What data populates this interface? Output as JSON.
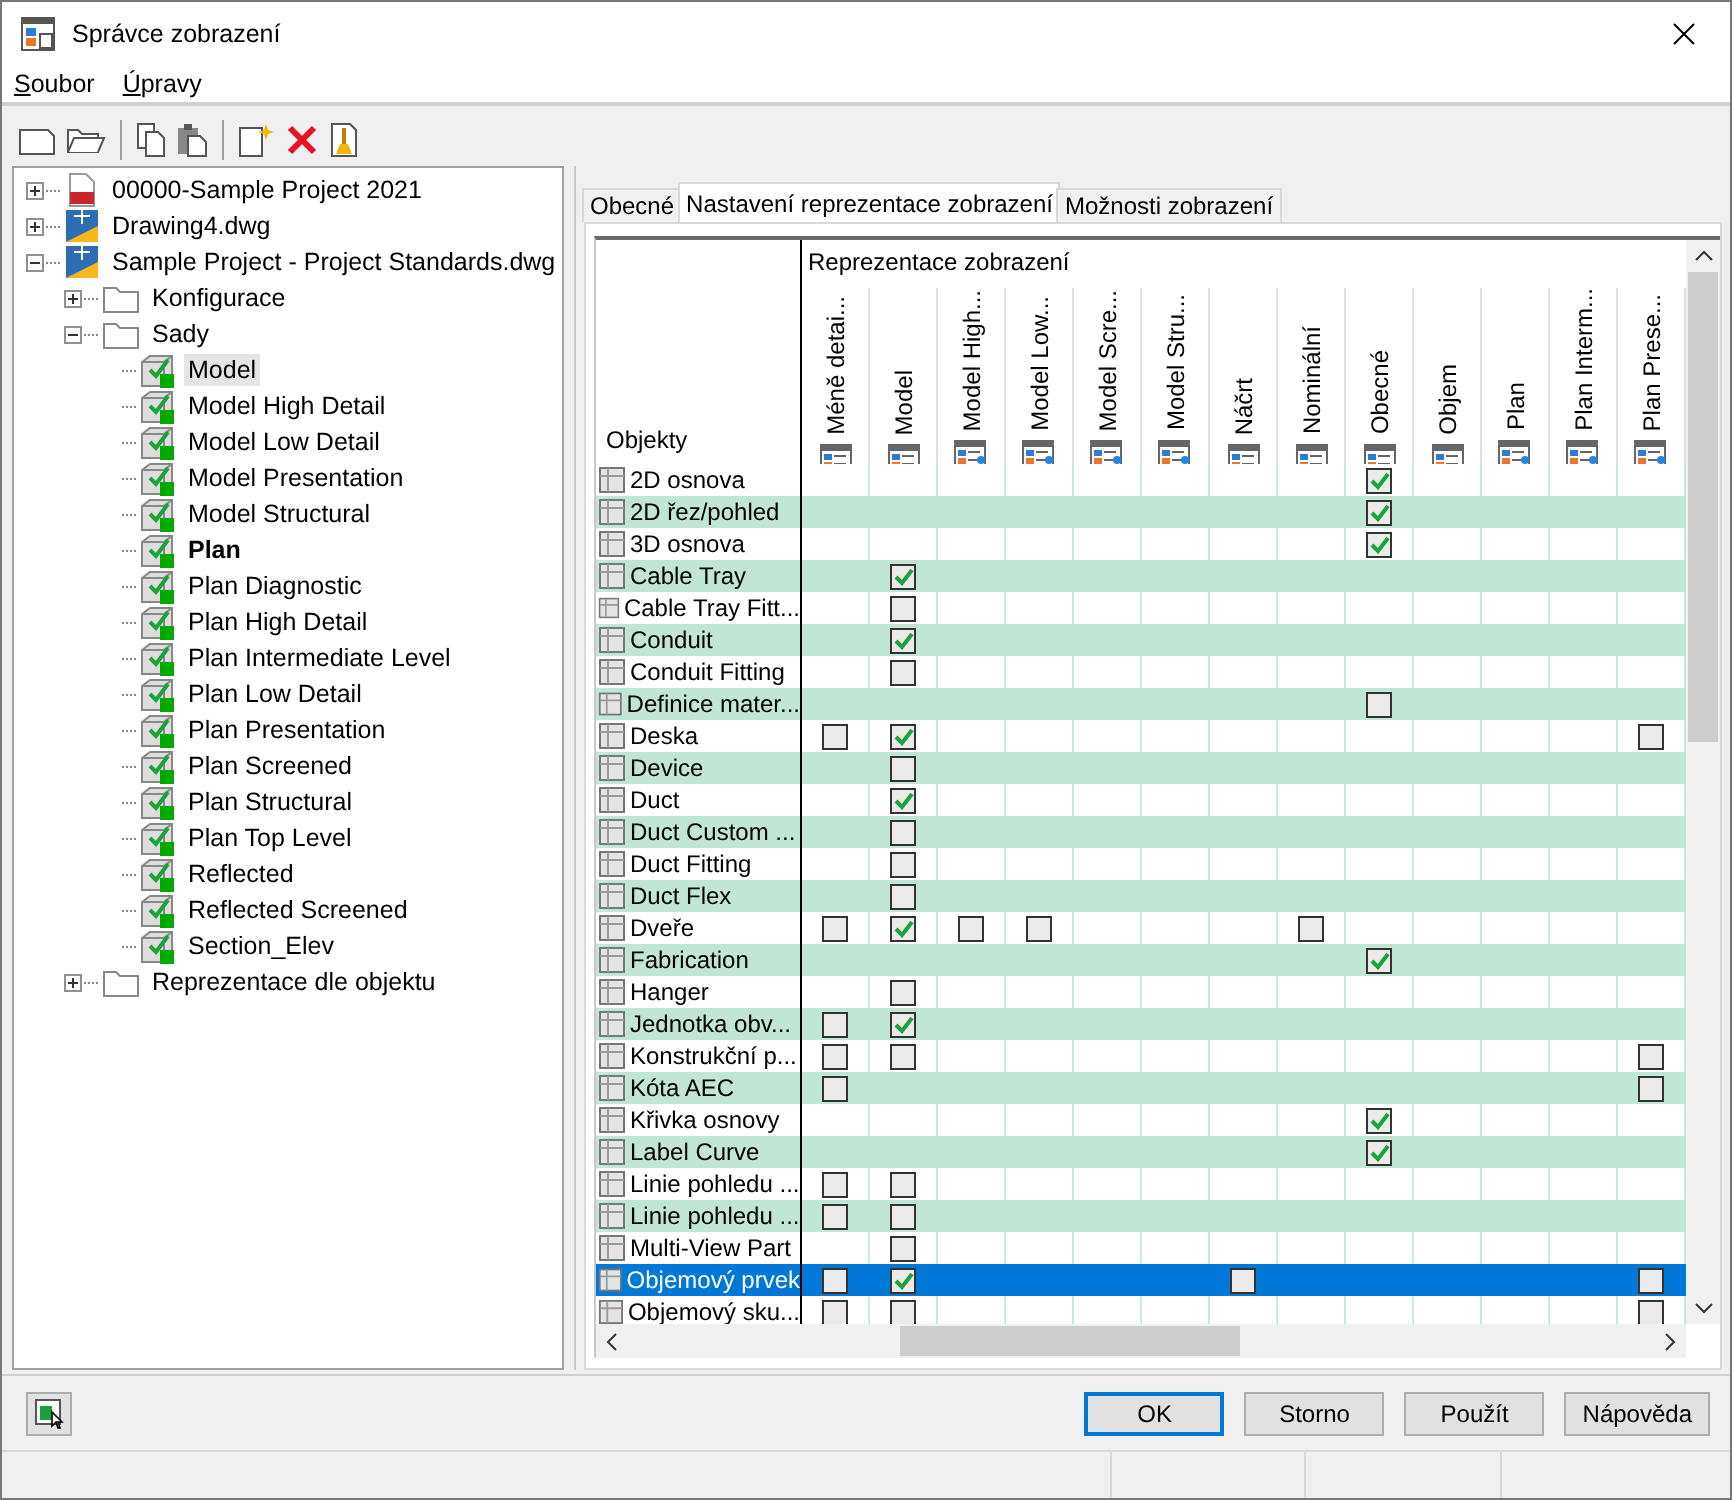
{
  "window": {
    "title": "Správce zobrazení"
  },
  "menu": [
    "Soubor",
    "Úpravy"
  ],
  "tree": [
    {
      "label": "00000-Sample Project 2021",
      "kind": "project",
      "expanded": false
    },
    {
      "label": "Drawing4.dwg",
      "kind": "drawing",
      "expanded": false
    },
    {
      "label": "Sample Project - Project Standards.dwg",
      "kind": "drawing",
      "expanded": true,
      "children": [
        {
          "label": "Konfigurace",
          "kind": "folder",
          "expanded": false
        },
        {
          "label": "Sady",
          "kind": "folder",
          "expanded": true,
          "children": [
            {
              "label": "Model",
              "kind": "set",
              "selected": true,
              "active": false
            },
            {
              "label": "Model High Detail",
              "kind": "set",
              "selected": false,
              "active": false
            },
            {
              "label": "Model Low Detail",
              "kind": "set",
              "selected": false,
              "active": false
            },
            {
              "label": "Model Presentation",
              "kind": "set",
              "selected": false,
              "active": false
            },
            {
              "label": "Model Structural",
              "kind": "set",
              "selected": false,
              "active": false
            },
            {
              "label": "Plan",
              "kind": "set",
              "selected": false,
              "active": true
            },
            {
              "label": "Plan Diagnostic",
              "kind": "set",
              "selected": false,
              "active": false
            },
            {
              "label": "Plan High Detail",
              "kind": "set",
              "selected": false,
              "active": false
            },
            {
              "label": "Plan Intermediate Level",
              "kind": "set",
              "selected": false,
              "active": false
            },
            {
              "label": "Plan Low Detail",
              "kind": "set",
              "selected": false,
              "active": false
            },
            {
              "label": "Plan Presentation",
              "kind": "set",
              "selected": false,
              "active": false
            },
            {
              "label": "Plan Screened",
              "kind": "set",
              "selected": false,
              "active": false
            },
            {
              "label": "Plan Structural",
              "kind": "set",
              "selected": false,
              "active": false
            },
            {
              "label": "Plan Top Level",
              "kind": "set",
              "selected": false,
              "active": false
            },
            {
              "label": "Reflected",
              "kind": "set",
              "selected": false,
              "active": false
            },
            {
              "label": "Reflected Screened",
              "kind": "set",
              "selected": false,
              "active": false
            },
            {
              "label": "Section_Elev",
              "kind": "set",
              "selected": false,
              "active": false
            }
          ]
        },
        {
          "label": "Reprezentace dle objektu",
          "kind": "folder",
          "expanded": false
        }
      ]
    }
  ],
  "tabs": [
    {
      "label": "Obecné",
      "selected": false
    },
    {
      "label": "Nastavení reprezentace zobrazení",
      "selected": true
    },
    {
      "label": "Možnosti zobrazení",
      "selected": false
    }
  ],
  "table": {
    "group_label": "Reprezentace zobrazení",
    "row_header": "Objekty",
    "columns": [
      {
        "label": "Méně detai...",
        "kind": "standard"
      },
      {
        "label": "Model",
        "kind": "standard"
      },
      {
        "label": "Model High...",
        "kind": "custom"
      },
      {
        "label": "Model Low...",
        "kind": "custom"
      },
      {
        "label": "Model Scre...",
        "kind": "custom"
      },
      {
        "label": "Model Stru...",
        "kind": "custom"
      },
      {
        "label": "Náčrt",
        "kind": "standard"
      },
      {
        "label": "Nominální",
        "kind": "standard"
      },
      {
        "label": "Obecné",
        "kind": "standard"
      },
      {
        "label": "Objem",
        "kind": "standard"
      },
      {
        "label": "Plan",
        "kind": "custom"
      },
      {
        "label": "Plan Interm...",
        "kind": "custom"
      },
      {
        "label": "Plan Prese...",
        "kind": "custom"
      }
    ],
    "rows": [
      {
        "label": "2D osnova",
        "selected": false,
        "cells": [
          null,
          null,
          null,
          null,
          null,
          null,
          null,
          null,
          true,
          null,
          null,
          null,
          null
        ]
      },
      {
        "label": "2D řez/pohled",
        "selected": false,
        "cells": [
          null,
          null,
          null,
          null,
          null,
          null,
          null,
          null,
          true,
          null,
          null,
          null,
          null
        ]
      },
      {
        "label": "3D osnova",
        "selected": false,
        "cells": [
          null,
          null,
          null,
          null,
          null,
          null,
          null,
          null,
          true,
          null,
          null,
          null,
          null
        ]
      },
      {
        "label": "Cable Tray",
        "selected": false,
        "cells": [
          null,
          true,
          null,
          null,
          null,
          null,
          null,
          null,
          null,
          null,
          null,
          null,
          null
        ]
      },
      {
        "label": "Cable Tray Fitt...",
        "selected": false,
        "cells": [
          null,
          false,
          null,
          null,
          null,
          null,
          null,
          null,
          null,
          null,
          null,
          null,
          null
        ]
      },
      {
        "label": "Conduit",
        "selected": false,
        "cells": [
          null,
          true,
          null,
          null,
          null,
          null,
          null,
          null,
          null,
          null,
          null,
          null,
          null
        ]
      },
      {
        "label": "Conduit Fitting",
        "selected": false,
        "cells": [
          null,
          false,
          null,
          null,
          null,
          null,
          null,
          null,
          null,
          null,
          null,
          null,
          null
        ]
      },
      {
        "label": "Definice mater...",
        "selected": false,
        "cells": [
          null,
          null,
          null,
          null,
          null,
          null,
          null,
          null,
          false,
          null,
          null,
          null,
          null
        ]
      },
      {
        "label": "Deska",
        "selected": false,
        "cells": [
          false,
          true,
          null,
          null,
          null,
          null,
          null,
          null,
          null,
          null,
          null,
          null,
          false
        ]
      },
      {
        "label": "Device",
        "selected": false,
        "cells": [
          null,
          false,
          null,
          null,
          null,
          null,
          null,
          null,
          null,
          null,
          null,
          null,
          null
        ]
      },
      {
        "label": "Duct",
        "selected": false,
        "cells": [
          null,
          true,
          null,
          null,
          null,
          null,
          null,
          null,
          null,
          null,
          null,
          null,
          null
        ]
      },
      {
        "label": "Duct Custom ...",
        "selected": false,
        "cells": [
          null,
          false,
          null,
          null,
          null,
          null,
          null,
          null,
          null,
          null,
          null,
          null,
          null
        ]
      },
      {
        "label": "Duct Fitting",
        "selected": false,
        "cells": [
          null,
          false,
          null,
          null,
          null,
          null,
          null,
          null,
          null,
          null,
          null,
          null,
          null
        ]
      },
      {
        "label": "Duct Flex",
        "selected": false,
        "cells": [
          null,
          false,
          null,
          null,
          null,
          null,
          null,
          null,
          null,
          null,
          null,
          null,
          null
        ]
      },
      {
        "label": "Dveře",
        "selected": false,
        "cells": [
          false,
          true,
          false,
          false,
          null,
          null,
          null,
          false,
          null,
          null,
          null,
          null,
          null
        ]
      },
      {
        "label": "Fabrication",
        "selected": false,
        "cells": [
          null,
          null,
          null,
          null,
          null,
          null,
          null,
          null,
          true,
          null,
          null,
          null,
          null
        ]
      },
      {
        "label": "Hanger",
        "selected": false,
        "cells": [
          null,
          false,
          null,
          null,
          null,
          null,
          null,
          null,
          null,
          null,
          null,
          null,
          null
        ]
      },
      {
        "label": "Jednotka obv...",
        "selected": false,
        "cells": [
          false,
          true,
          null,
          null,
          null,
          null,
          null,
          null,
          null,
          null,
          null,
          null,
          null
        ]
      },
      {
        "label": "Konstrukční p...",
        "selected": false,
        "cells": [
          false,
          false,
          null,
          null,
          null,
          null,
          null,
          null,
          null,
          null,
          null,
          null,
          false
        ]
      },
      {
        "label": "Kóta AEC",
        "selected": false,
        "cells": [
          false,
          null,
          null,
          null,
          null,
          null,
          null,
          null,
          null,
          null,
          null,
          null,
          false
        ]
      },
      {
        "label": "Křivka osnovy",
        "selected": false,
        "cells": [
          null,
          null,
          null,
          null,
          null,
          null,
          null,
          null,
          true,
          null,
          null,
          null,
          null
        ]
      },
      {
        "label": "Label Curve",
        "selected": false,
        "cells": [
          null,
          null,
          null,
          null,
          null,
          null,
          null,
          null,
          true,
          null,
          null,
          null,
          null
        ]
      },
      {
        "label": "Linie pohledu ...",
        "selected": false,
        "cells": [
          false,
          false,
          null,
          null,
          null,
          null,
          null,
          null,
          null,
          null,
          null,
          null,
          null
        ]
      },
      {
        "label": "Linie pohledu ...",
        "selected": false,
        "cells": [
          false,
          false,
          null,
          null,
          null,
          null,
          null,
          null,
          null,
          null,
          null,
          null,
          null
        ]
      },
      {
        "label": "Multi-View Part",
        "selected": false,
        "cells": [
          null,
          false,
          null,
          null,
          null,
          null,
          null,
          null,
          null,
          null,
          null,
          null,
          null
        ]
      },
      {
        "label": "Objemový prvek",
        "selected": true,
        "cells": [
          false,
          true,
          null,
          null,
          null,
          null,
          false,
          null,
          null,
          null,
          null,
          null,
          false
        ]
      },
      {
        "label": "Objemový sku...",
        "selected": false,
        "cells": [
          false,
          false,
          null,
          null,
          null,
          null,
          null,
          null,
          null,
          null,
          null,
          null,
          false
        ]
      }
    ]
  },
  "buttons": [
    {
      "label": "OK",
      "default": true
    },
    {
      "label": "Storno",
      "default": false
    },
    {
      "label": "Použít",
      "default": false
    },
    {
      "label": "Nápověda",
      "default": false
    }
  ]
}
